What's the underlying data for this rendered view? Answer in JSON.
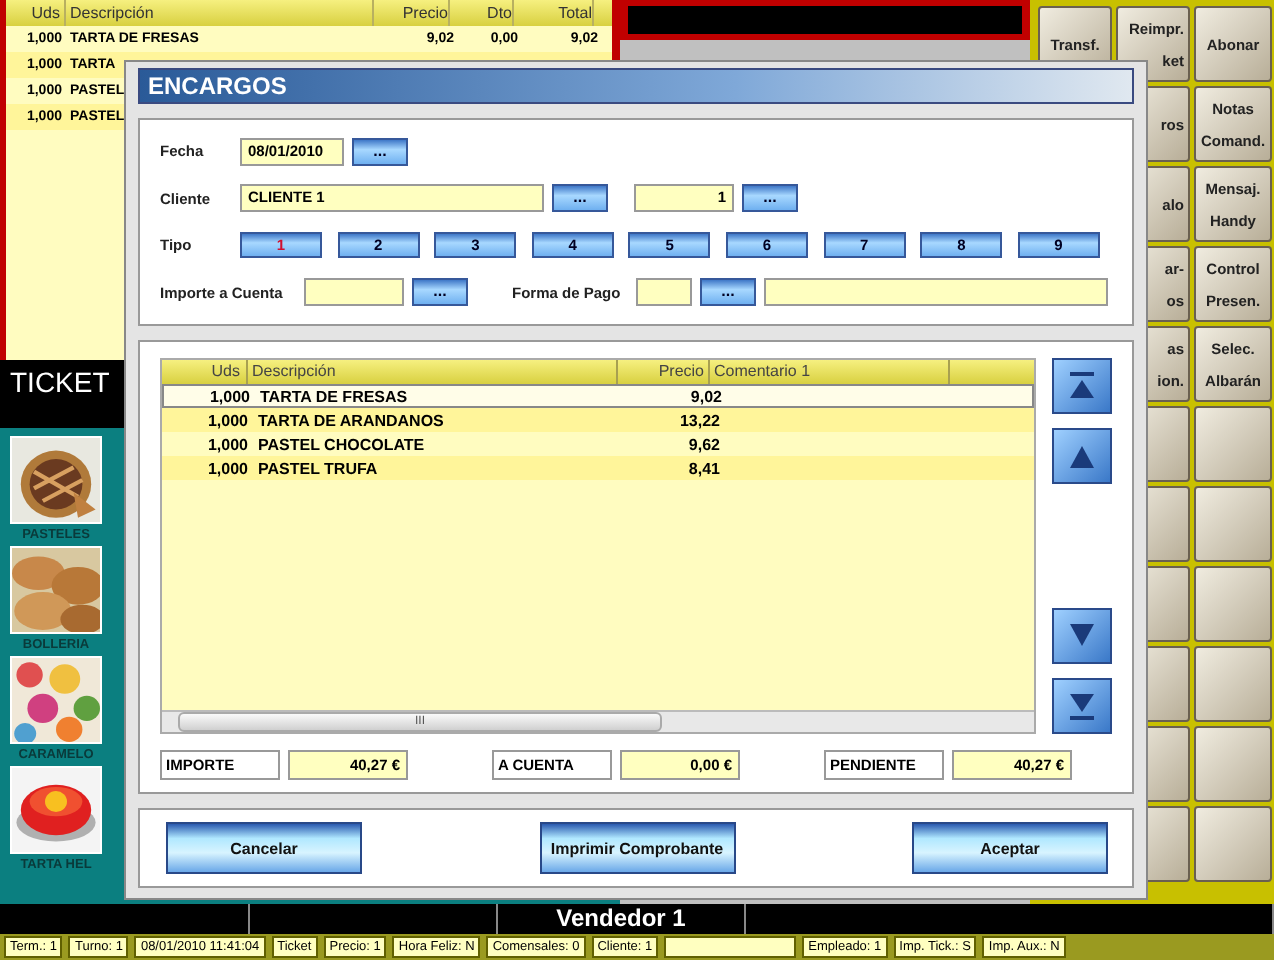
{
  "ticket": {
    "columns": [
      "Uds",
      "Descripción",
      "Precio",
      "Dto",
      "Total"
    ],
    "rows": [
      {
        "uds": "1,000",
        "desc": "TARTA DE FRESAS",
        "precio": "9,02",
        "dto": "0,00",
        "total": "9,02"
      },
      {
        "uds": "1,000",
        "desc": "TARTA"
      },
      {
        "uds": "1,000",
        "desc": "PASTEL"
      },
      {
        "uds": "1,000",
        "desc": "PASTEL"
      }
    ],
    "label": "TICKET"
  },
  "categories": [
    {
      "label": "PASTELES",
      "kind": "picture"
    },
    {
      "label": "BOLLERIA",
      "kind": "picture"
    },
    {
      "label": "CARAMELO",
      "kind": "picture"
    },
    {
      "label": "TARTA HEL",
      "kind": "picture"
    }
  ],
  "button_columns": [
    [
      {
        "kind": "label",
        "lines": [
          "Transf."
        ]
      }
    ],
    [
      {
        "kind": "label",
        "lines": [
          "Reimpr.",
          "ket"
        ]
      },
      {
        "kind": "label",
        "lines": [
          "ros"
        ]
      },
      {
        "kind": "label",
        "lines": [
          "alo"
        ]
      },
      {
        "kind": "label",
        "lines": [
          "ar-",
          "os"
        ]
      },
      {
        "kind": "label",
        "lines": [
          "as",
          "ion."
        ]
      },
      {
        "kind": "blank"
      },
      {
        "kind": "blank"
      },
      {
        "kind": "blank"
      },
      {
        "kind": "blank"
      },
      {
        "kind": "blank"
      },
      {
        "kind": "blank"
      }
    ],
    [
      {
        "kind": "label",
        "lines": [
          "Abonar"
        ]
      },
      {
        "kind": "label",
        "lines": [
          "Notas",
          "Comand."
        ]
      },
      {
        "kind": "label",
        "lines": [
          "Mensaj.",
          "Handy"
        ]
      },
      {
        "kind": "label",
        "lines": [
          "Control",
          "Presen."
        ]
      },
      {
        "kind": "label",
        "lines": [
          "Selec.",
          "Albarán"
        ]
      },
      {
        "kind": "blank"
      },
      {
        "kind": "blank"
      },
      {
        "kind": "blank"
      },
      {
        "kind": "blank"
      },
      {
        "kind": "blank"
      },
      {
        "kind": "blank"
      }
    ]
  ],
  "dialog": {
    "title": "ENCARGOS",
    "fecha": {
      "label": "Fecha",
      "value": "08/01/2010",
      "button": "..."
    },
    "cliente": {
      "label": "Cliente",
      "value": "CLIENTE 1",
      "button": "...",
      "number": "1",
      "number_button": "..."
    },
    "tipo": {
      "label": "Tipo",
      "options": [
        {
          "label": "1",
          "selected": true
        },
        {
          "label": "2",
          "selected": false
        },
        {
          "label": "3",
          "selected": false
        },
        {
          "label": "4",
          "selected": false
        },
        {
          "label": "5",
          "selected": false
        },
        {
          "label": "6",
          "selected": false
        },
        {
          "label": "7",
          "selected": false
        },
        {
          "label": "8",
          "selected": false
        },
        {
          "label": "9",
          "selected": false
        }
      ]
    },
    "importe_cuenta": {
      "label": "Importe a Cuenta",
      "button": "..."
    },
    "forma_pago": {
      "label": "Forma de Pago",
      "button": "..."
    },
    "table": {
      "columns": [
        "Uds",
        "Descripción",
        "Precio",
        "Comentario 1"
      ],
      "rows": [
        {
          "uds": "1,000",
          "desc": "TARTA DE FRESAS",
          "precio": "9,02",
          "selected": true
        },
        {
          "uds": "1,000",
          "desc": "TARTA DE ARANDANOS",
          "precio": "13,22",
          "selected": false
        },
        {
          "uds": "1,000",
          "desc": "PASTEL CHOCOLATE",
          "precio": "9,62",
          "selected": false
        },
        {
          "uds": "1,000",
          "desc": "PASTEL TRUFA",
          "precio": "8,41",
          "selected": false
        }
      ],
      "scroll_marker": "III"
    },
    "totals": [
      {
        "label": "IMPORTE",
        "value": "40,27 €"
      },
      {
        "label": "A CUENTA",
        "value": "0,00 €"
      },
      {
        "label": "PENDIENTE",
        "value": "40,27 €"
      }
    ],
    "buttons": [
      "Cancelar",
      "Imprimir Comprobante",
      "Aceptar"
    ]
  },
  "vendor": "Vendedor 1",
  "status_bar": [
    {
      "kind": "text",
      "text": "Term.: 1"
    },
    {
      "kind": "text",
      "text": "Turno: 1"
    },
    {
      "kind": "text",
      "text": "08/01/2010 11:41:04"
    },
    {
      "kind": "text",
      "text": "Ticket"
    },
    {
      "kind": "text",
      "text": "Precio: 1"
    },
    {
      "kind": "text",
      "text": "Hora Feliz: N"
    },
    {
      "kind": "text",
      "text": "Comensales: 0"
    },
    {
      "kind": "text",
      "text": "Cliente: 1"
    },
    {
      "kind": "blank"
    },
    {
      "kind": "text",
      "text": "Empleado: 1"
    },
    {
      "kind": "text",
      "text": "Imp. Tick.: S"
    },
    {
      "kind": "text",
      "text": "Imp. Aux.: N"
    }
  ]
}
